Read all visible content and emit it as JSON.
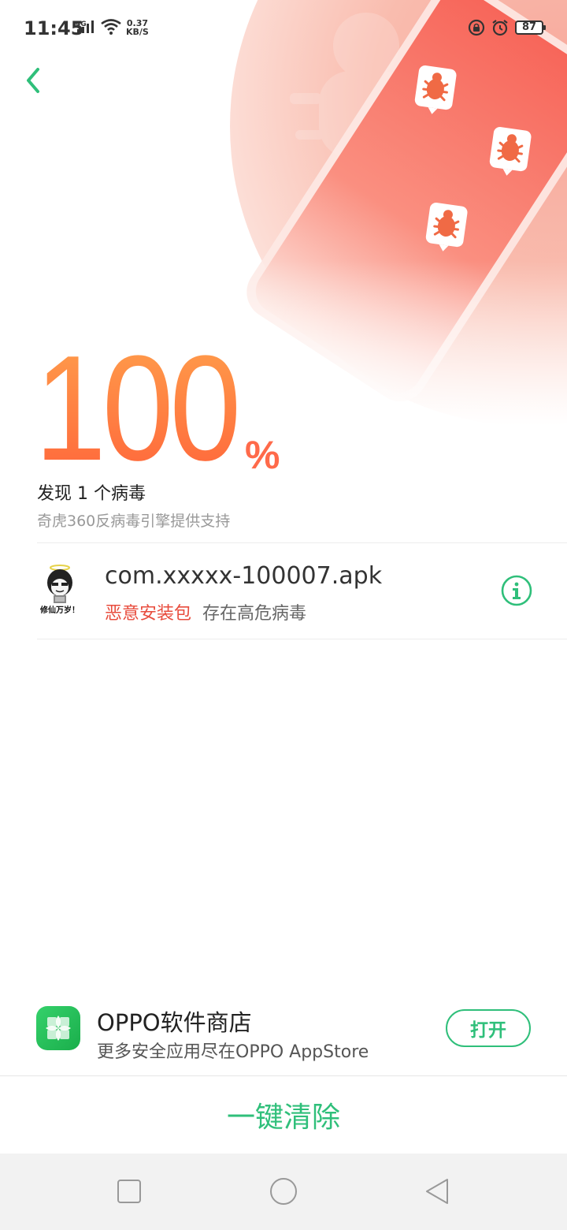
{
  "status_bar": {
    "time": "11:45",
    "network": "4G",
    "speed_value": "0.37",
    "speed_unit": "KB/S",
    "battery": "87"
  },
  "scan": {
    "percent": "100",
    "percent_sign": "%",
    "result": "发现 1 个病毒",
    "engine_note": "奇虎360反病毒引擎提供支持"
  },
  "threat": {
    "avatar_text": "修仙万岁！",
    "file_name": "com.xxxxx-100007.apk",
    "tag": "恶意安装包",
    "description": "存在高危病毒"
  },
  "store": {
    "name": "OPPO软件商店",
    "description": "更多安全应用尽在OPPO AppStore",
    "open_label": "打开"
  },
  "actions": {
    "clean_label": "一键清除"
  },
  "colors": {
    "accent_green": "#2fbf7a",
    "danger_red": "#e84c3d",
    "percent_orange": "#ff7a42"
  },
  "icons": [
    "back-arrow-icon",
    "bug-icon",
    "info-icon",
    "app-store-icon",
    "recent-apps-icon",
    "home-icon",
    "back-triangle-icon"
  ]
}
